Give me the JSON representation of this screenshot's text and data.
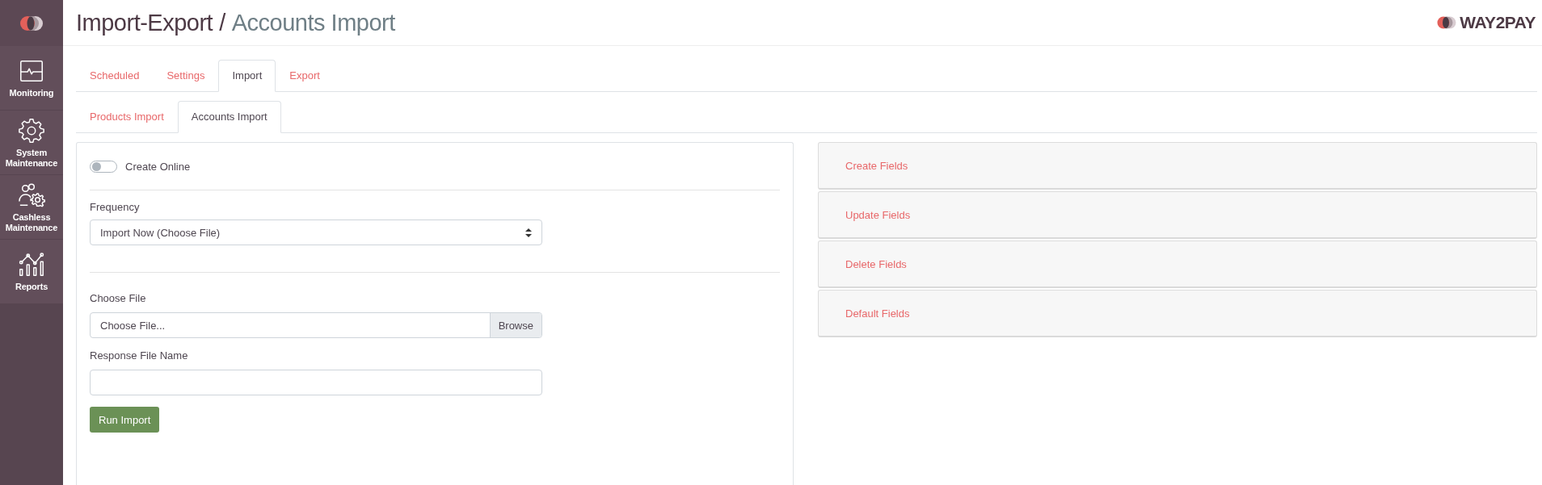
{
  "sidebar": {
    "items": [
      {
        "label": "Monitoring",
        "kind": "monitor"
      },
      {
        "label": "System Maintenance",
        "kind": "gear"
      },
      {
        "label": "Cashless Maintenance",
        "kind": "people"
      },
      {
        "label": "Reports",
        "kind": "chart"
      }
    ]
  },
  "header": {
    "title": "Import-Export",
    "separator": "/",
    "subtitle": "Accounts Import",
    "logo": "WAY2PAY"
  },
  "tabs": [
    {
      "label": "Scheduled",
      "selected": false
    },
    {
      "label": "Settings",
      "selected": false
    },
    {
      "label": "Import",
      "selected": true
    },
    {
      "label": "Export",
      "selected": false
    }
  ],
  "subtabs": [
    {
      "label": "Products Import",
      "selected": false
    },
    {
      "label": "Accounts Import",
      "selected": true
    }
  ],
  "form": {
    "create_online": {
      "label": "Create Online",
      "on": false
    },
    "frequency": {
      "label": "Frequency",
      "value": "Import Now (Choose File)"
    },
    "choose_file": {
      "label": "Choose File",
      "text": "Choose File...",
      "button": "Browse"
    },
    "response_file": {
      "label": "Response File Name"
    },
    "submit": "Run Import"
  },
  "panels": [
    {
      "title": "Create Fields"
    },
    {
      "title": "Update Fields"
    },
    {
      "title": "Delete Fields"
    },
    {
      "title": "Default Fields"
    }
  ]
}
